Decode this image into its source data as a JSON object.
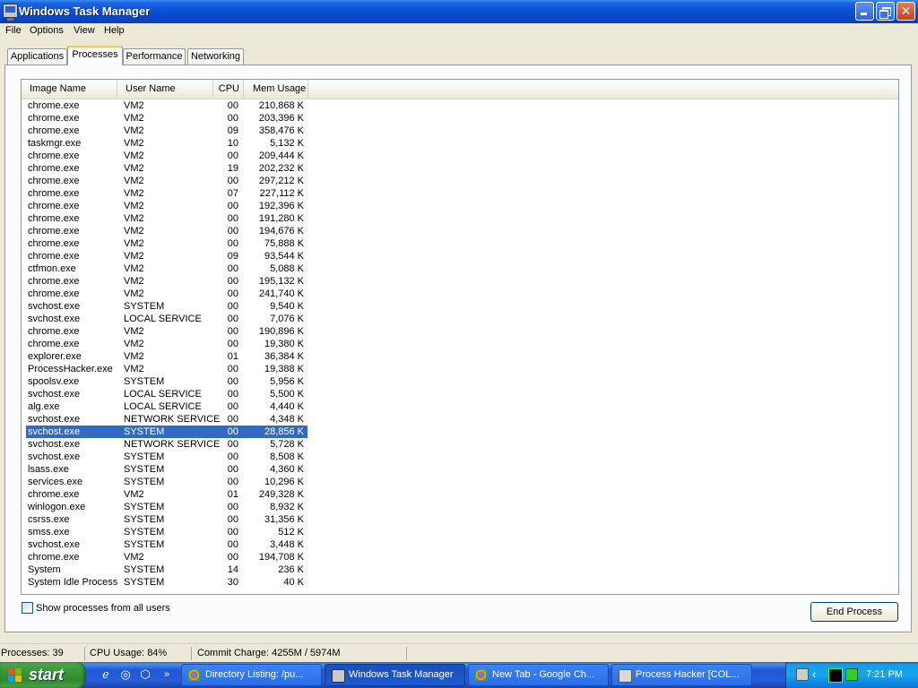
{
  "window": {
    "title": "Windows Task Manager"
  },
  "menu": [
    "File",
    "Options",
    "View",
    "Help"
  ],
  "tabs": [
    "Applications",
    "Processes",
    "Performance",
    "Networking"
  ],
  "columns": [
    "Image Name",
    "User Name",
    "CPU",
    "Mem Usage"
  ],
  "processes": [
    {
      "name": "chrome.exe",
      "user": "VM2",
      "cpu": "00",
      "mem": "210,868 K"
    },
    {
      "name": "chrome.exe",
      "user": "VM2",
      "cpu": "00",
      "mem": "203,396 K"
    },
    {
      "name": "chrome.exe",
      "user": "VM2",
      "cpu": "09",
      "mem": "358,476 K"
    },
    {
      "name": "taskmgr.exe",
      "user": "VM2",
      "cpu": "10",
      "mem": "5,132 K"
    },
    {
      "name": "chrome.exe",
      "user": "VM2",
      "cpu": "00",
      "mem": "209,444 K"
    },
    {
      "name": "chrome.exe",
      "user": "VM2",
      "cpu": "19",
      "mem": "202,232 K"
    },
    {
      "name": "chrome.exe",
      "user": "VM2",
      "cpu": "00",
      "mem": "297,212 K"
    },
    {
      "name": "chrome.exe",
      "user": "VM2",
      "cpu": "07",
      "mem": "227,112 K"
    },
    {
      "name": "chrome.exe",
      "user": "VM2",
      "cpu": "00",
      "mem": "192,396 K"
    },
    {
      "name": "chrome.exe",
      "user": "VM2",
      "cpu": "00",
      "mem": "191,280 K"
    },
    {
      "name": "chrome.exe",
      "user": "VM2",
      "cpu": "00",
      "mem": "194,676 K"
    },
    {
      "name": "chrome.exe",
      "user": "VM2",
      "cpu": "00",
      "mem": "75,888 K"
    },
    {
      "name": "chrome.exe",
      "user": "VM2",
      "cpu": "09",
      "mem": "93,544 K"
    },
    {
      "name": "ctfmon.exe",
      "user": "VM2",
      "cpu": "00",
      "mem": "5,088 K"
    },
    {
      "name": "chrome.exe",
      "user": "VM2",
      "cpu": "00",
      "mem": "195,132 K"
    },
    {
      "name": "chrome.exe",
      "user": "VM2",
      "cpu": "00",
      "mem": "241,740 K"
    },
    {
      "name": "svchost.exe",
      "user": "SYSTEM",
      "cpu": "00",
      "mem": "9,540 K"
    },
    {
      "name": "svchost.exe",
      "user": "LOCAL SERVICE",
      "cpu": "00",
      "mem": "7,076 K"
    },
    {
      "name": "chrome.exe",
      "user": "VM2",
      "cpu": "00",
      "mem": "190,896 K"
    },
    {
      "name": "chrome.exe",
      "user": "VM2",
      "cpu": "00",
      "mem": "19,380 K"
    },
    {
      "name": "explorer.exe",
      "user": "VM2",
      "cpu": "01",
      "mem": "36,384 K"
    },
    {
      "name": "ProcessHacker.exe",
      "user": "VM2",
      "cpu": "00",
      "mem": "19,388 K"
    },
    {
      "name": "spoolsv.exe",
      "user": "SYSTEM",
      "cpu": "00",
      "mem": "5,956 K"
    },
    {
      "name": "svchost.exe",
      "user": "LOCAL SERVICE",
      "cpu": "00",
      "mem": "5,500 K"
    },
    {
      "name": "alg.exe",
      "user": "LOCAL SERVICE",
      "cpu": "00",
      "mem": "4,440 K"
    },
    {
      "name": "svchost.exe",
      "user": "NETWORK SERVICE",
      "cpu": "00",
      "mem": "4,348 K"
    },
    {
      "name": "svchost.exe",
      "user": "SYSTEM",
      "cpu": "00",
      "mem": "28,856 K",
      "selected": true
    },
    {
      "name": "svchost.exe",
      "user": "NETWORK SERVICE",
      "cpu": "00",
      "mem": "5,728 K"
    },
    {
      "name": "svchost.exe",
      "user": "SYSTEM",
      "cpu": "00",
      "mem": "8,508 K"
    },
    {
      "name": "lsass.exe",
      "user": "SYSTEM",
      "cpu": "00",
      "mem": "4,360 K"
    },
    {
      "name": "services.exe",
      "user": "SYSTEM",
      "cpu": "00",
      "mem": "10,296 K"
    },
    {
      "name": "chrome.exe",
      "user": "VM2",
      "cpu": "01",
      "mem": "249,328 K"
    },
    {
      "name": "winlogon.exe",
      "user": "SYSTEM",
      "cpu": "00",
      "mem": "8,932 K"
    },
    {
      "name": "csrss.exe",
      "user": "SYSTEM",
      "cpu": "00",
      "mem": "31,356 K"
    },
    {
      "name": "smss.exe",
      "user": "SYSTEM",
      "cpu": "00",
      "mem": "512 K"
    },
    {
      "name": "svchost.exe",
      "user": "SYSTEM",
      "cpu": "00",
      "mem": "3,448 K"
    },
    {
      "name": "chrome.exe",
      "user": "VM2",
      "cpu": "00",
      "mem": "194,708 K"
    },
    {
      "name": "System",
      "user": "SYSTEM",
      "cpu": "14",
      "mem": "236 K"
    },
    {
      "name": "System Idle Process",
      "user": "SYSTEM",
      "cpu": "30",
      "mem": "40 K"
    }
  ],
  "show_all_label": "Show processes from all users",
  "end_process_label": "End Process",
  "status": {
    "processes": "Processes: 39",
    "cpu": "CPU Usage: 84%",
    "commit": "Commit Charge: 4255M / 5974M"
  },
  "taskbar": {
    "start_label": "start",
    "items": [
      {
        "label": "Directory Listing: /pu...",
        "icon": "chrome-icon"
      },
      {
        "label": "Windows Task Manager",
        "icon": "task-manager-icon",
        "active": true
      },
      {
        "label": "New Tab - Google Ch...",
        "icon": "chrome-icon"
      },
      {
        "label": "Process Hacker [COL...",
        "icon": "process-hacker-icon"
      }
    ],
    "clock": "7:21 PM"
  },
  "colors": {
    "selection": "#316ac5",
    "titlebar": "#0a50d8",
    "taskbar": "#245edb",
    "start": "#3a9a3a"
  }
}
